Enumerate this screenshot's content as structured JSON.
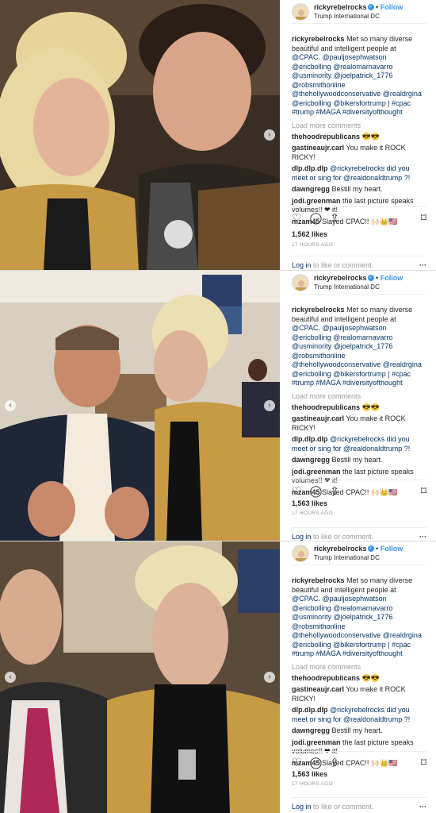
{
  "posts": [
    {
      "username": "rickyrebelrocks",
      "follow": "Follow",
      "location": "Trump International DC",
      "caption_text": "Met so many diverse beautiful and intelligent people at",
      "caption_tags": "@CPAC. @pauljosephwatson @ericbolling @realomarnavarro @usminority @joelpatrick_1776 @robsmithonline @thehollywoodconservative @realdrgina @ericbolling @bikersfortrump | #cpac #trump #MAGA #diversityofthought",
      "load_more": "Load more comments",
      "comments": [
        {
          "user": "thehoodrepublicans",
          "text": "😎😎"
        },
        {
          "user": "gastineaujr.carl",
          "text": "You make it ROCK RICKY!"
        },
        {
          "user": "dlp.dlp.dlp",
          "text": "@rickyrebelrocks did you meet or sing for @realdonaldtrump ?!"
        },
        {
          "user": "dawngregg",
          "text": "Bestill my heart."
        },
        {
          "user": "jodi.greenman",
          "text": "the last picture speaks volumes!! ❤ it!"
        },
        {
          "user": "mzam45",
          "text": "Slayed CPAC!! 🙌🏻👑🇺🇸"
        }
      ],
      "likes": "1,562 likes",
      "time": "17 HOURS AGO",
      "login_link": "Log in",
      "login_text": "to like or comment."
    },
    {
      "username": "rickyrebelrocks",
      "follow": "Follow",
      "location": "Trump International DC",
      "caption_text": "Met so many diverse beautiful and intelligent people at",
      "caption_tags": "@CPAC. @pauljosephwatson @ericbolling @realomarnavarro @usminority @joelpatrick_1776 @robsmithonline @thehollywoodconservative @realdrgina @ericbolling @bikersfortrump | #cpac #trump #MAGA #diversityofthought",
      "load_more": "Load more comments",
      "comments": [
        {
          "user": "thehoodrepublicans",
          "text": "😎😎"
        },
        {
          "user": "gastineaujr.carl",
          "text": "You make it ROCK RICKY!"
        },
        {
          "user": "dlp.dlp.dlp",
          "text": "@rickyrebelrocks did you meet or sing for @realdonaldtrump ?!"
        },
        {
          "user": "dawngregg",
          "text": "Bestill my heart."
        },
        {
          "user": "jodi.greenman",
          "text": "the last picture speaks volumes!! ❤ it!"
        },
        {
          "user": "mzam45",
          "text": "Slayed CPAC!! 🙌🏻👑🇺🇸"
        }
      ],
      "likes": "1,563 likes",
      "time": "17 HOURS AGO",
      "login_link": "Log in",
      "login_text": "to like or comment."
    },
    {
      "username": "rickyrebelrocks",
      "follow": "Follow",
      "location": "Trump International DC",
      "caption_text": "Met so many diverse beautiful and intelligent people at",
      "caption_tags": "@CPAC. @pauljosephwatson @ericbolling @realomarnavarro @usminority @joelpatrick_1776 @robsmithonline @thehollywoodconservative @realdrgina @ericbolling @bikersfortrump | #cpac #trump #MAGA #diversityofthought",
      "load_more": "Load more comments",
      "comments": [
        {
          "user": "thehoodrepublicans",
          "text": "😎😎"
        },
        {
          "user": "gastineaujr.carl",
          "text": "You make it ROCK RICKY!"
        },
        {
          "user": "dlp.dlp.dlp",
          "text": "@rickyrebelrocks did you meet or sing for @realdonaldtrump ?!"
        },
        {
          "user": "dawngregg",
          "text": "Bestill my heart."
        },
        {
          "user": "jodi.greenman",
          "text": "the last picture speaks volumes!! ❤ it!"
        },
        {
          "user": "mzam45",
          "text": "Slayed CPAC!! 🙌🏻👑🇺🇸"
        }
      ],
      "likes": "1,563 likes",
      "time": "17 HOURS AGO",
      "login_link": "Log in",
      "login_text": "to like or comment."
    }
  ],
  "icons": {
    "heart": "heart-icon",
    "comment": "comment-icon",
    "share": "share-icon",
    "save": "bookmark-icon",
    "verified": "verified-badge-icon",
    "more": "more-options-icon"
  },
  "colors": {
    "link": "#003569",
    "accent": "#3897f0",
    "muted": "#999999"
  }
}
